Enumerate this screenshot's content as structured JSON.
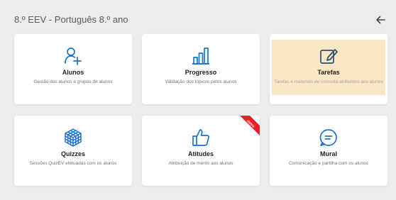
{
  "header": {
    "title": "8.º EEV - Português 8.º ano",
    "back_icon": "arrow-left-icon"
  },
  "colors": {
    "icon_blue": "#1a73c9",
    "highlight": "#fae7c3",
    "ribbon_red": "#e8202a"
  },
  "cards": [
    {
      "label": "Alunos",
      "desc": "Gestão dos alunos e grupos de alunos",
      "icon": "user-add-icon"
    },
    {
      "label": "Progresso",
      "desc": "Validação dos tópicos pelos alunos",
      "icon": "bar-chart-icon"
    },
    {
      "label": "Tarefas",
      "desc": "Tarefas e materiais de consulta atribuídos aos alunos",
      "icon": "edit-icon",
      "highlighted": true
    },
    {
      "label": "Quizzes",
      "desc": "Sessões QuizEV efetuadas com os alunos",
      "icon": "cube-icon"
    },
    {
      "label": "Atitudes",
      "desc": "Atribuição de mérito aos alunos",
      "icon": "thumbs-up-icon",
      "badge": "novo"
    },
    {
      "label": "Mural",
      "desc": "Comunicação e partilha com os alunos",
      "icon": "chat-icon"
    }
  ]
}
